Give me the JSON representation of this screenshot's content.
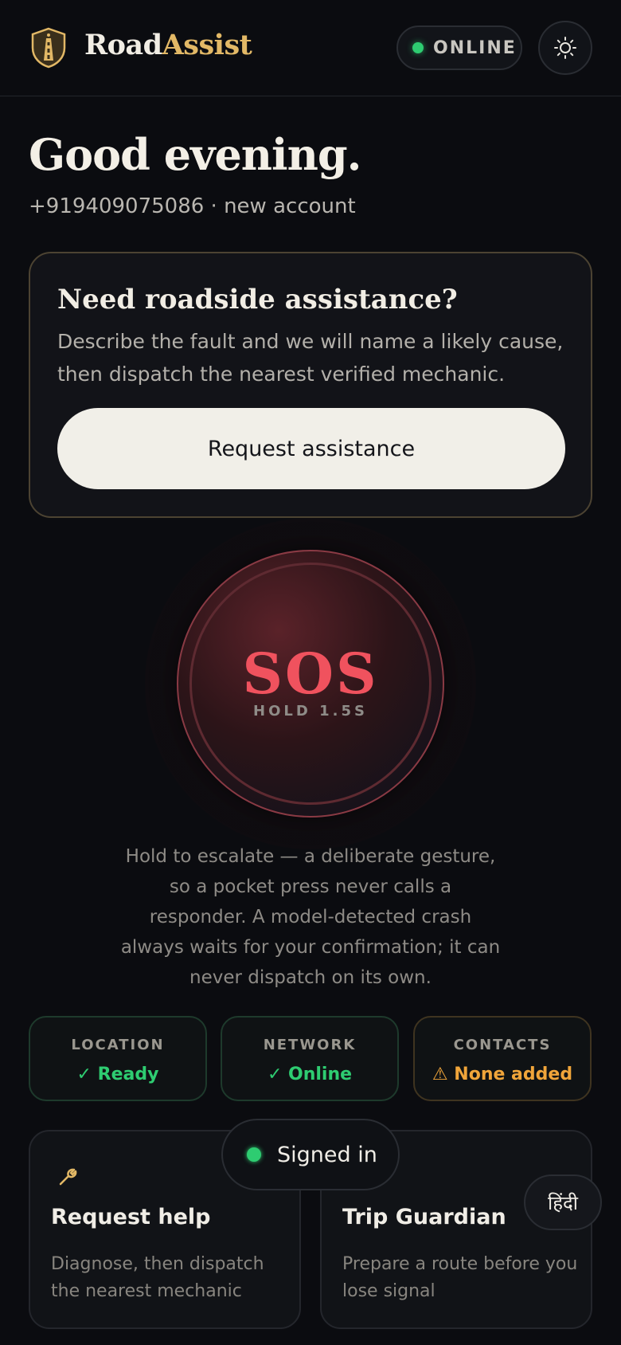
{
  "header": {
    "brand_part1": "Road",
    "brand_part2": "Assist",
    "status": "ONLINE",
    "logo_icon": "shield-road-icon",
    "theme_icon": "sun-icon"
  },
  "greeting": {
    "title": "Good evening.",
    "account": "+919409075086 · new account"
  },
  "assist_card": {
    "title": "Need roadside assistance?",
    "description": "Describe the fault and we will name a likely cause, then dispatch the nearest verified mechanic.",
    "button": "Request assistance"
  },
  "sos": {
    "label": "SOS",
    "hold": "HOLD 1.5S",
    "note": "Hold to escalate — a deliberate gesture, so a pocket press never calls a responder. A model-detected crash always waits for your confirmation; it can never dispatch on its own."
  },
  "status_cards": [
    {
      "title": "LOCATION",
      "value": "✓ Ready",
      "state": "ok"
    },
    {
      "title": "NETWORK",
      "value": "✓ Online",
      "state": "ok"
    },
    {
      "title": "CONTACTS",
      "value": "⚠ None added",
      "state": "warn"
    }
  ],
  "features": [
    {
      "title": "Request help",
      "description": "Diagnose, then dispatch the nearest mechanic",
      "icon": "wrench-icon"
    },
    {
      "title": "Trip Guardian",
      "description": "Prepare a route before you lose signal"
    }
  ],
  "toast": {
    "label": "Signed in"
  },
  "language_button": "हिंदी",
  "colors": {
    "accent_gold": "#e2b866",
    "sos_red": "#f0525e",
    "ok_green": "#2ecc71",
    "warn_orange": "#f0a53a",
    "background": "#0b0c10"
  }
}
